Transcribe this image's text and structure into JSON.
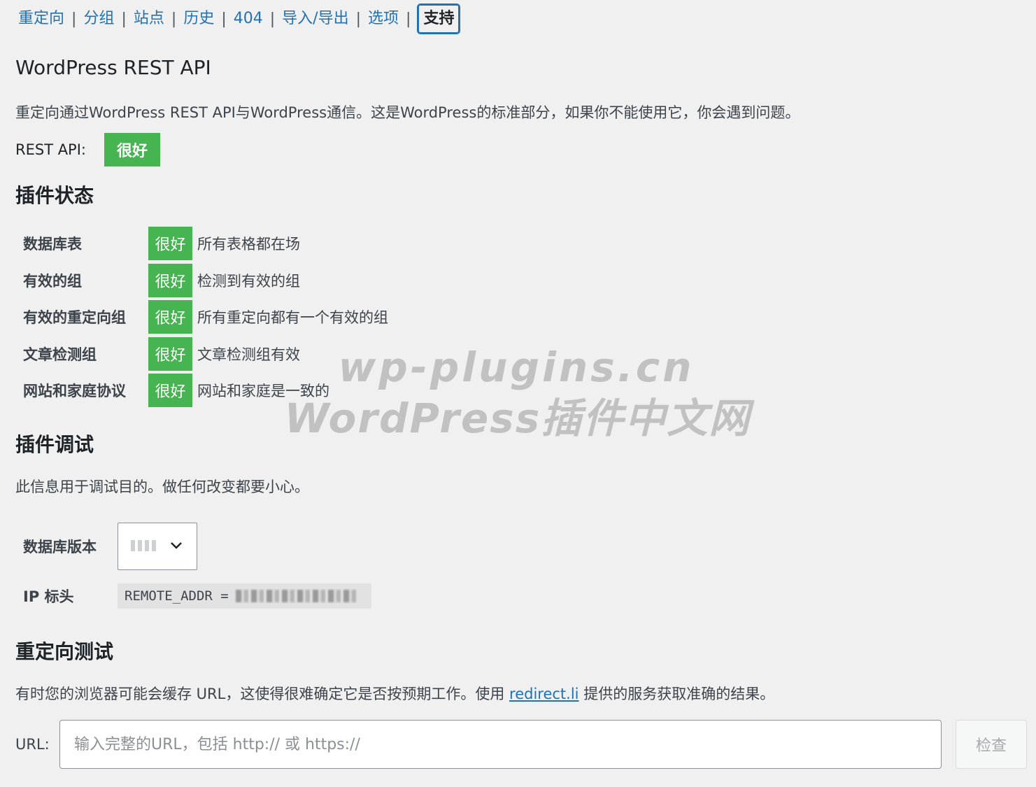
{
  "nav": {
    "tabs": [
      "重定向",
      "分组",
      "站点",
      "历史",
      "404",
      "导入/导出",
      "选项",
      "支持"
    ],
    "separator": "|",
    "active": "支持"
  },
  "rest": {
    "title": "WordPress REST API",
    "description": "重定向通过WordPress REST API与WordPress通信。这是WordPress的标准部分，如果你不能使用它，你会遇到问题。",
    "label": "REST API:",
    "status": "很好"
  },
  "plugin_status": {
    "title": "插件状态",
    "rows": [
      {
        "label": "数据库表",
        "status": "很好",
        "message": "所有表格都在场"
      },
      {
        "label": "有效的组",
        "status": "很好",
        "message": "检测到有效的组"
      },
      {
        "label": "有效的重定向组",
        "status": "很好",
        "message": "所有重定向都有一个有效的组"
      },
      {
        "label": "文章检测组",
        "status": "很好",
        "message": "文章检测组有效"
      },
      {
        "label": "网站和家庭协议",
        "status": "很好",
        "message": "网站和家庭是一致的"
      }
    ]
  },
  "debug": {
    "title": "插件调试",
    "description": "此信息用于调试目的。做任何改变都要小心。",
    "db_version_label": "数据库版本",
    "ip_header_label": "IP 标头",
    "ip_header_value": "REMOTE_ADDR ="
  },
  "redirect_test": {
    "title": "重定向测试",
    "description_before": "有时您的浏览器可能会缓存 URL，这使得很难确定它是否按预期工作。使用",
    "link_text": "redirect.li",
    "description_after": "提供的服务获取准确的结果。",
    "url_label": "URL:",
    "url_placeholder": "输入完整的URL，包括 http:// 或 https://",
    "check_button": "检查"
  },
  "watermark": {
    "line1": "wp-plugins.cn",
    "line2": "WordPress插件中文网"
  },
  "colors": {
    "link": "#2271b1",
    "success": "#46b450",
    "background": "#f0f0f1"
  }
}
